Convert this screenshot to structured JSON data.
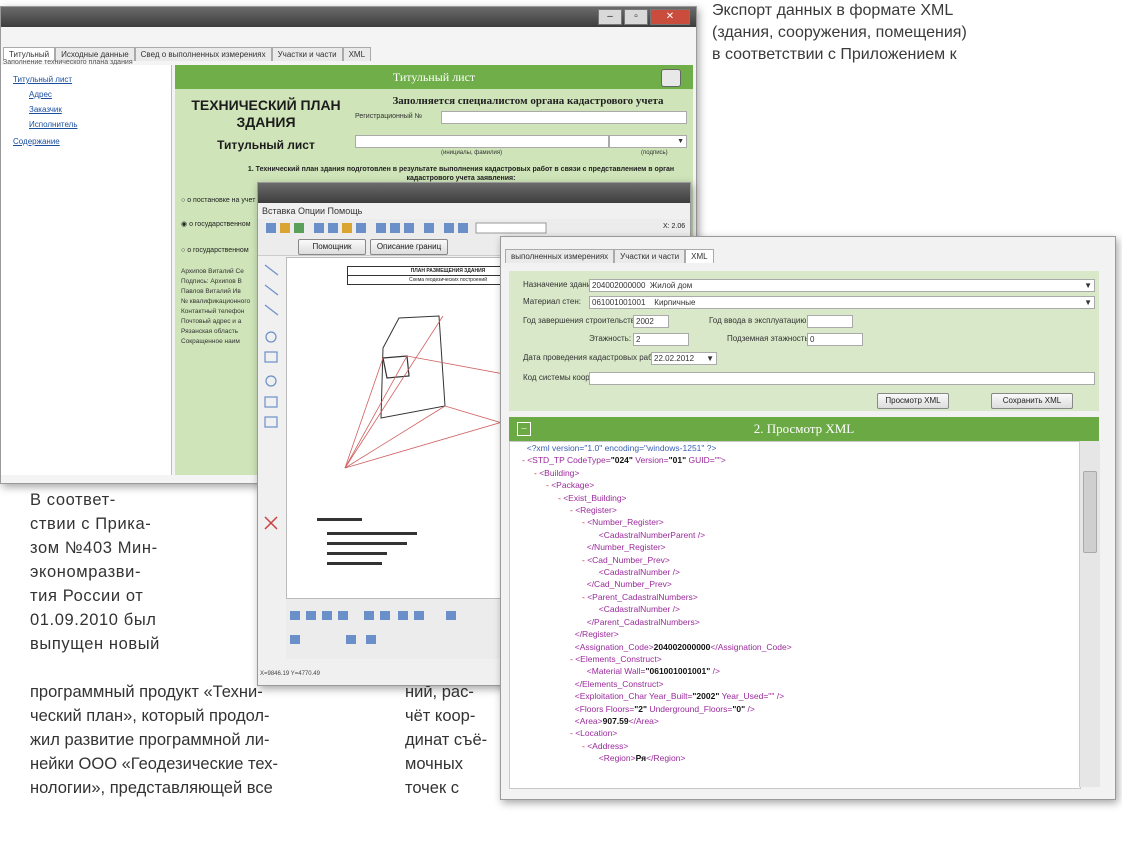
{
  "article": {
    "top_lines": [
      "Экспорт данных в формате XML",
      "(здания, сооружения, помещения)",
      "в соответствии с Приложением к"
    ],
    "left_lines": [
      "В соответ-",
      "ствии с Прика-",
      "зом №403 Мин-",
      "экономразви-",
      "тия России от",
      "01.09.2010 был",
      "выпущен новый"
    ],
    "bottom_lines": [
      "программный продукт «Техни-",
      "ческий план», который продол-",
      "жил развитие программной ли-",
      "нейки ООО «Геодезические тех-",
      "нологии», представляющей все"
    ],
    "col_lines": [
      "ний, рас-",
      "чёт коор-",
      "динат съё-",
      "мочных",
      "точек с"
    ]
  },
  "window1": {
    "tabs": [
      "Титульный",
      "Исходные данные",
      "Свед о выполненных измерениях",
      "Участки и части",
      "XML"
    ],
    "tree_root": "Заполнение технического плана здания",
    "tree_items": [
      "Титульный лист",
      "Адрес",
      "Заказчик",
      "Исполнитель",
      "Содержание"
    ],
    "header": "Титульный лист",
    "doc_title_1": "ТЕХНИЧЕСКИЙ ПЛАН",
    "doc_title_2": "ЗДАНИЯ",
    "doc_subtitle": "Титульный лист",
    "cadastral_heading": "Заполняется специалистом органа кадастрового учета",
    "reg_label": "Регистрационный №",
    "signature_label": "(инициалы, фамилия)",
    "sign_label": "(подпись)",
    "paragraph": "1. Технический план здания подготовлен в результате выполнения кадастровых работ в связи с представлением в орган кадастрового учета заявления:",
    "radio_labels": [
      "о постановке на учет",
      "о государственном",
      "о государственном"
    ],
    "left_fields": [
      "Архипов Виталий Се",
      "Подпись: Архипов В",
      "Павлов Виталий Ив",
      "№ квалификационного",
      "Контактный телефон",
      "Почтовый адрес и а",
      "Рязанская область",
      "Сокращенное наим"
    ]
  },
  "window2": {
    "menu": "Вставка  Опции  Помощь",
    "toolbar_btns": [
      "Помощник",
      "Описание границ"
    ],
    "coords": "X: 2.06",
    "status": "X=9846.19   Y=4770.49",
    "canvas_lines": [
      "ПЛАН РАЗМЕЩЕНИЯ ЗДАНИЯ",
      "Схема геодезических построений"
    ]
  },
  "window3": {
    "tabs": [
      "выполненных измерениях",
      "Участки и части",
      "XML"
    ],
    "fields": {
      "purpose_label": "Назначение здания:",
      "purpose_code": "204002000000",
      "purpose_value": "Жилой дом",
      "walls_label": "Материал стен:",
      "walls_code": "061001001001",
      "walls_value": "Кирпичные",
      "year_built_label": "Год завершения строительства:",
      "year_built": "2002",
      "year_used_label": "Год ввода в эксплуатацию:",
      "floors_label": "Этажность:",
      "floors": "2",
      "underground_label": "Подземная этажность:",
      "underground": "0",
      "date_label": "Дата проведения кадастровых работ:",
      "date": "22.02.2012",
      "coords_label": "Код системы координат:"
    },
    "buttons": {
      "view": "Просмотр XML",
      "save": "Сохранить XML"
    },
    "xml_header": "2. Просмотр XML",
    "xml_lines": [
      {
        "indent": 0,
        "minus": false,
        "html": "<span class='pi'>&lt;?xml version=\"1.0\" encoding=\"windows-1251\" ?&gt;</span>"
      },
      {
        "indent": 0,
        "minus": true,
        "html": "<span class='tag'>&lt;STD_TP CodeType=</span><span class='val'>\"024\"</span><span class='tag'> Version=</span><span class='val'>\"01\"</span><span class='tag'> GUID=\"\"&gt;</span>"
      },
      {
        "indent": 1,
        "minus": true,
        "html": "<span class='tag'>&lt;Building&gt;</span>"
      },
      {
        "indent": 2,
        "minus": true,
        "html": "<span class='tag'>&lt;Package&gt;</span>"
      },
      {
        "indent": 3,
        "minus": true,
        "html": "<span class='tag'>&lt;Exist_Building&gt;</span>"
      },
      {
        "indent": 4,
        "minus": true,
        "html": "<span class='tag'>&lt;Register&gt;</span>"
      },
      {
        "indent": 5,
        "minus": true,
        "html": "<span class='tag'>&lt;Number_Register&gt;</span>"
      },
      {
        "indent": 6,
        "minus": false,
        "html": "<span class='tag'>&lt;CadastralNumberParent /&gt;</span>"
      },
      {
        "indent": 5,
        "minus": false,
        "html": "<span class='tag'>&lt;/Number_Register&gt;</span>"
      },
      {
        "indent": 5,
        "minus": true,
        "html": "<span class='tag'>&lt;Cad_Number_Prev&gt;</span>"
      },
      {
        "indent": 6,
        "minus": false,
        "html": "<span class='tag'>&lt;CadastralNumber /&gt;</span>"
      },
      {
        "indent": 5,
        "minus": false,
        "html": "<span class='tag'>&lt;/Cad_Number_Prev&gt;</span>"
      },
      {
        "indent": 5,
        "minus": true,
        "html": "<span class='tag'>&lt;Parent_CadastralNumbers&gt;</span>"
      },
      {
        "indent": 6,
        "minus": false,
        "html": "<span class='tag'>&lt;CadastralNumber /&gt;</span>"
      },
      {
        "indent": 5,
        "minus": false,
        "html": "<span class='tag'>&lt;/Parent_CadastralNumbers&gt;</span>"
      },
      {
        "indent": 4,
        "minus": false,
        "html": "<span class='tag'>&lt;/Register&gt;</span>"
      },
      {
        "indent": 4,
        "minus": false,
        "html": "<span class='tag'>&lt;Assignation_Code&gt;</span><span class='val'>204002000000</span><span class='tag'>&lt;/Assignation_Code&gt;</span>"
      },
      {
        "indent": 4,
        "minus": true,
        "html": "<span class='tag'>&lt;Elements_Construct&gt;</span>"
      },
      {
        "indent": 5,
        "minus": false,
        "html": "<span class='tag'>&lt;Material Wall=</span><span class='val'>\"061001001001\"</span><span class='tag'> /&gt;</span>"
      },
      {
        "indent": 4,
        "minus": false,
        "html": "<span class='tag'>&lt;/Elements_Construct&gt;</span>"
      },
      {
        "indent": 4,
        "minus": false,
        "html": "<span class='tag'>&lt;Exploitation_Char Year_Built=</span><span class='val'>\"2002\"</span><span class='tag'> Year_Used=\"\" /&gt;</span>"
      },
      {
        "indent": 4,
        "minus": false,
        "html": "<span class='tag'>&lt;Floors Floors=</span><span class='val'>\"2\"</span><span class='tag'> Underground_Floors=</span><span class='val'>\"0\"</span><span class='tag'> /&gt;</span>"
      },
      {
        "indent": 4,
        "minus": false,
        "html": "<span class='tag'>&lt;Area&gt;</span><span class='val'>907.59</span><span class='tag'>&lt;/Area&gt;</span>"
      },
      {
        "indent": 4,
        "minus": true,
        "html": "<span class='tag'>&lt;Location&gt;</span>"
      },
      {
        "indent": 5,
        "minus": true,
        "html": "<span class='tag'>&lt;Address&gt;</span>"
      },
      {
        "indent": 6,
        "minus": false,
        "html": "<span class='tag'>&lt;Region&gt;</span><span class='val'>Ря</span><span class='tag'>&lt;/Region&gt;</span>"
      }
    ]
  }
}
